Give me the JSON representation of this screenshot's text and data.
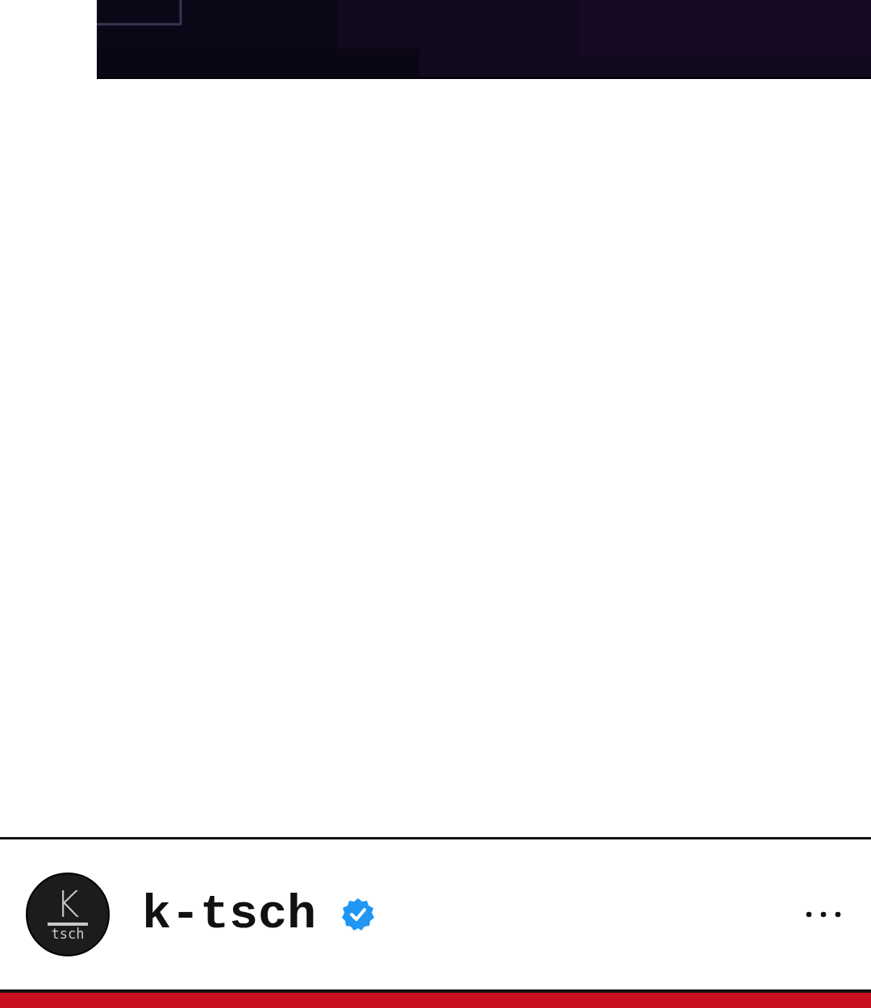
{
  "header": {
    "avatar": {
      "letter": "K",
      "caption": "tsch"
    },
    "username": "k-tsch",
    "verified": true
  }
}
